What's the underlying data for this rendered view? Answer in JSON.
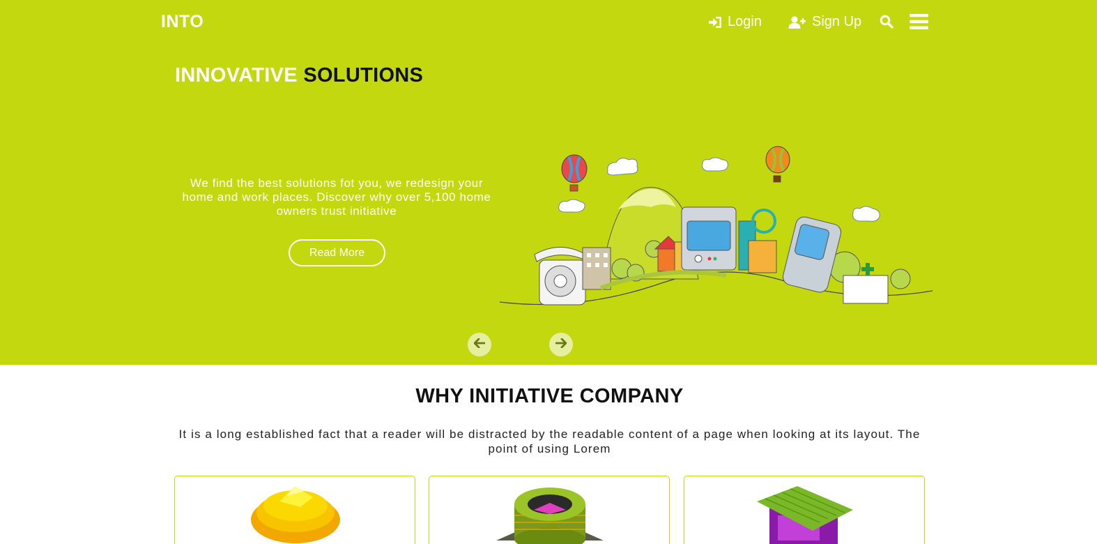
{
  "header": {
    "logo": "INTO",
    "login_label": "Login",
    "signup_label": "Sign Up",
    "icons": [
      "sign-in-icon",
      "user-plus-icon",
      "search-icon",
      "menu-icon"
    ]
  },
  "hero": {
    "title_part1": "INNOVATIVE",
    "title_part2": "SOLUTIONS",
    "description": "We find the best solutions fot you, we redesign your home and work places. Discover why over 5,100 home owners trust initiative",
    "button_label": "Read More",
    "prev_icon": "arrow-left-icon",
    "next_icon": "arrow-right-icon"
  },
  "why": {
    "title": "WHY INITIATIVE COMPANY",
    "text": "It is a long established fact that a reader will be distracted by the readable content of a page when looking at its layout. The point of using Lorem"
  },
  "cards": [
    {
      "icon": "gold-layers-icon"
    },
    {
      "icon": "round-building-icon"
    },
    {
      "icon": "green-roof-house-icon"
    }
  ],
  "colors": {
    "accent": "#c4d80f",
    "text_dark": "#111111",
    "white": "#ffffff"
  }
}
